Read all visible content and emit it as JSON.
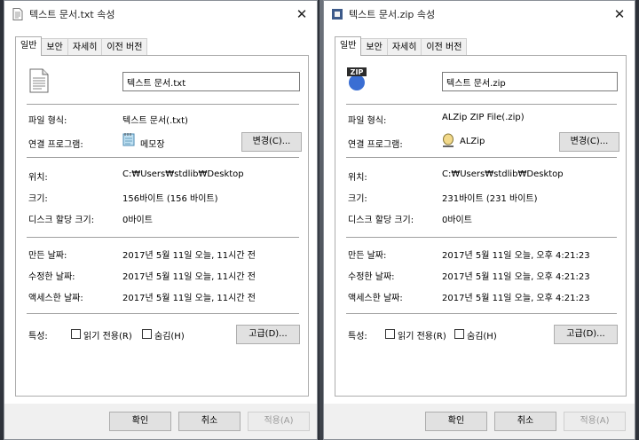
{
  "colors": {
    "window_bg": "#ffffff",
    "footer_bg": "#f0f0f0",
    "button_bg": "#e1e1e1",
    "separator": "#a0a0a0"
  },
  "left": {
    "title": "텍스트 문서.txt 속성",
    "title_icon": "text-file-icon",
    "tabs": [
      "일반",
      "보안",
      "자세히",
      "이전 버전"
    ],
    "file_icon": "text-document-icon",
    "filename": "텍스트 문서.txt",
    "labels": {
      "type": "파일 형식:",
      "opens_with": "연결 프로그램:",
      "location": "위치:",
      "size": "크기:",
      "size_on_disk": "디스크 할당 크기:",
      "created": "만든 날짜:",
      "modified": "수정한 날짜:",
      "accessed": "액세스한 날짜:",
      "attributes": "특성:"
    },
    "values": {
      "type": "텍스트 문서(.txt)",
      "app": "메모장",
      "app_icon": "notepad-icon",
      "location": "C:₩Users₩stdlib₩Desktop",
      "size": "156바이트 (156 바이트)",
      "size_on_disk": "0바이트",
      "created": "2017년 5월 11일 오늘, 11시간 전",
      "modified": "2017년 5월 11일 오늘, 11시간 전",
      "accessed": "2017년 5월 11일 오늘, 11시간 전"
    },
    "buttons": {
      "change": "변경(C)...",
      "advanced": "고급(D)...",
      "ok": "확인",
      "cancel": "취소",
      "apply": "적용(A)"
    },
    "checkboxes": {
      "readonly": "읽기 전용(R)",
      "hidden": "숨김(H)"
    }
  },
  "right": {
    "title": "텍스트 문서.zip 속성",
    "title_icon": "zip-file-icon",
    "tabs": [
      "일반",
      "보안",
      "자세히",
      "이전 버전"
    ],
    "file_icon": "zip-archive-icon",
    "file_icon_text": "ZIP",
    "filename": "텍스트 문서.zip",
    "labels": {
      "type": "파일 형식:",
      "opens_with": "연결 프로그램:",
      "location": "위치:",
      "size": "크기:",
      "size_on_disk": "디스크 할당 크기:",
      "created": "만든 날짜:",
      "modified": "수정한 날짜:",
      "accessed": "액세스한 날짜:",
      "attributes": "특성:"
    },
    "values": {
      "type": "ALZip ZIP File(.zip)",
      "app": "ALZip",
      "app_icon": "alzip-icon",
      "location": "C:₩Users₩stdlib₩Desktop",
      "size": "231바이트 (231 바이트)",
      "size_on_disk": "0바이트",
      "created": "2017년 5월 11일 오늘, 오후 4:21:23",
      "modified": "2017년 5월 11일 오늘, 오후 4:21:23",
      "accessed": "2017년 5월 11일 오늘, 오후 4:21:23"
    },
    "buttons": {
      "change": "변경(C)...",
      "advanced": "고급(D)...",
      "ok": "확인",
      "cancel": "취소",
      "apply": "적용(A)"
    },
    "checkboxes": {
      "readonly": "읽기 전용(R)",
      "hidden": "숨김(H)"
    }
  }
}
